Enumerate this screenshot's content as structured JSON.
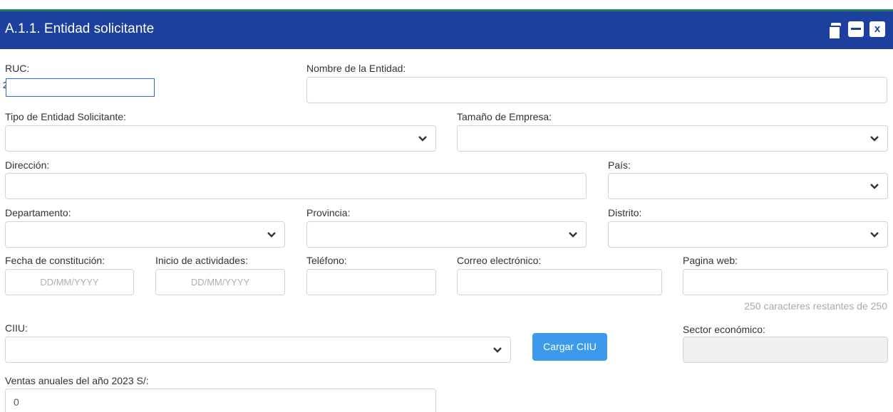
{
  "window": {
    "title": "A.1.1. Entidad solicitante",
    "icons": [
      "copy-icon",
      "minimize-icon",
      "close-icon"
    ],
    "close_glyph": "x"
  },
  "form": {
    "ruc": {
      "label": "RUC:",
      "value": "2"
    },
    "nombre": {
      "label": "Nombre de la Entidad:",
      "value": ""
    },
    "tipo": {
      "label": "Tipo de Entidad Solicitante:",
      "value": ""
    },
    "tamano": {
      "label": "Tamaño de Empresa:",
      "value": ""
    },
    "direccion": {
      "label": "Dirección:",
      "value": ""
    },
    "pais": {
      "label": "País:",
      "value": ""
    },
    "departamento": {
      "label": "Departamento:",
      "value": ""
    },
    "provincia": {
      "label": "Provincia:",
      "value": ""
    },
    "distrito": {
      "label": "Distrito:",
      "value": ""
    },
    "fecha_const": {
      "label": "Fecha de constitución:",
      "placeholder": "DD/MM/YYYY"
    },
    "inicio_act": {
      "label": "Inicio de actividades:",
      "placeholder": "DD/MM/YYYY"
    },
    "telefono": {
      "label": "Teléfono:",
      "value": ""
    },
    "correo": {
      "label": "Correo electrónico:",
      "value": ""
    },
    "web": {
      "label": "Pagina web:",
      "value": "",
      "counter": "250 caracteres restantes de 250"
    },
    "ciiu": {
      "label": "CIIU:",
      "value": "",
      "button": "Cargar CIIU"
    },
    "sector": {
      "label": "Sector económico:",
      "value": ""
    },
    "ventas": {
      "label": "Ventas anuales del año 2023 S/:",
      "value": "0"
    }
  },
  "colors": {
    "header": "#1d3f9e",
    "accent_strip": "#1f7a66",
    "button": "#3b9bea"
  }
}
